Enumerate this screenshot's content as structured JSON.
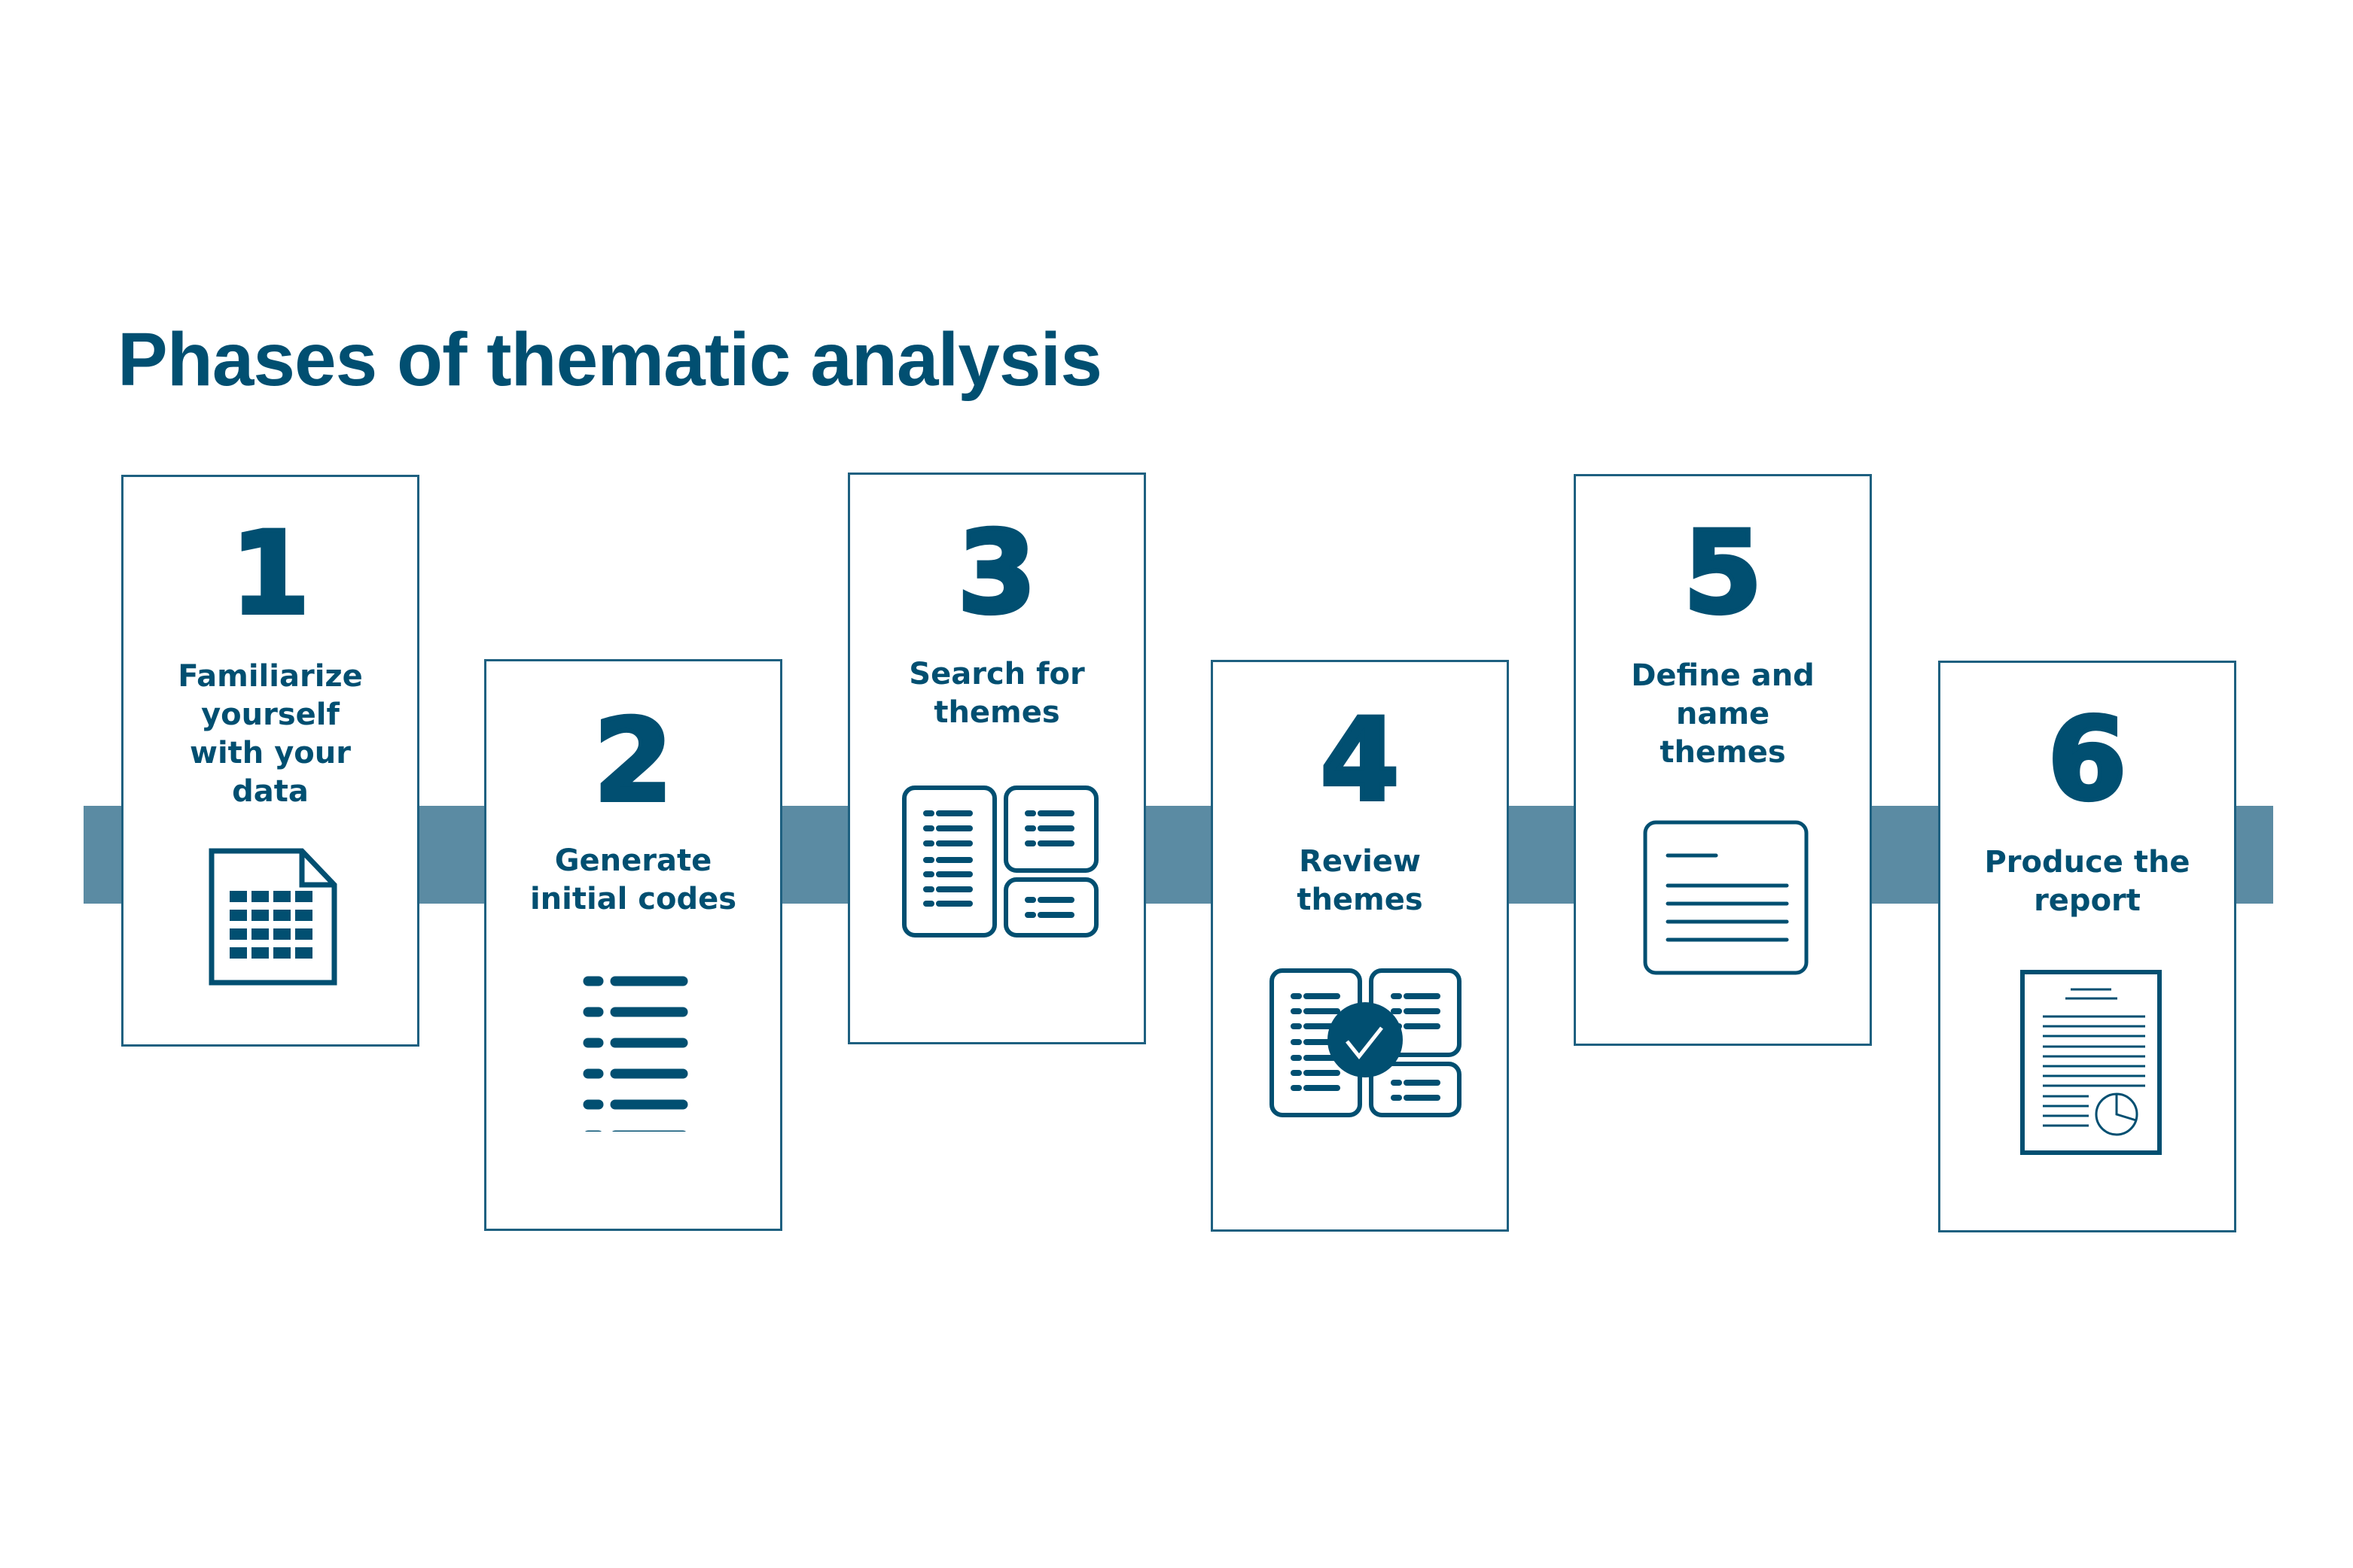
{
  "title": "Phases of thematic analysis",
  "colors": {
    "primary": "#014f71",
    "band": "#5b8ba3",
    "card_border": "#1e6080",
    "background": "#ffffff"
  },
  "phases": [
    {
      "number": "1",
      "label": "Familiarize\nyourself\nwith your\ndata",
      "icon": "spreadsheet-document-icon"
    },
    {
      "number": "2",
      "label": "Generate\ninitial codes",
      "icon": "bulleted-list-icon"
    },
    {
      "number": "3",
      "label": "Search for\nthemes",
      "icon": "grouped-lists-icon"
    },
    {
      "number": "4",
      "label": "Review\nthemes",
      "icon": "grouped-lists-checkmark-icon"
    },
    {
      "number": "5",
      "label": "Define and\nname\nthemes",
      "icon": "text-card-icon"
    },
    {
      "number": "6",
      "label": "Produce the\nreport",
      "icon": "report-document-pie-chart-icon"
    }
  ]
}
